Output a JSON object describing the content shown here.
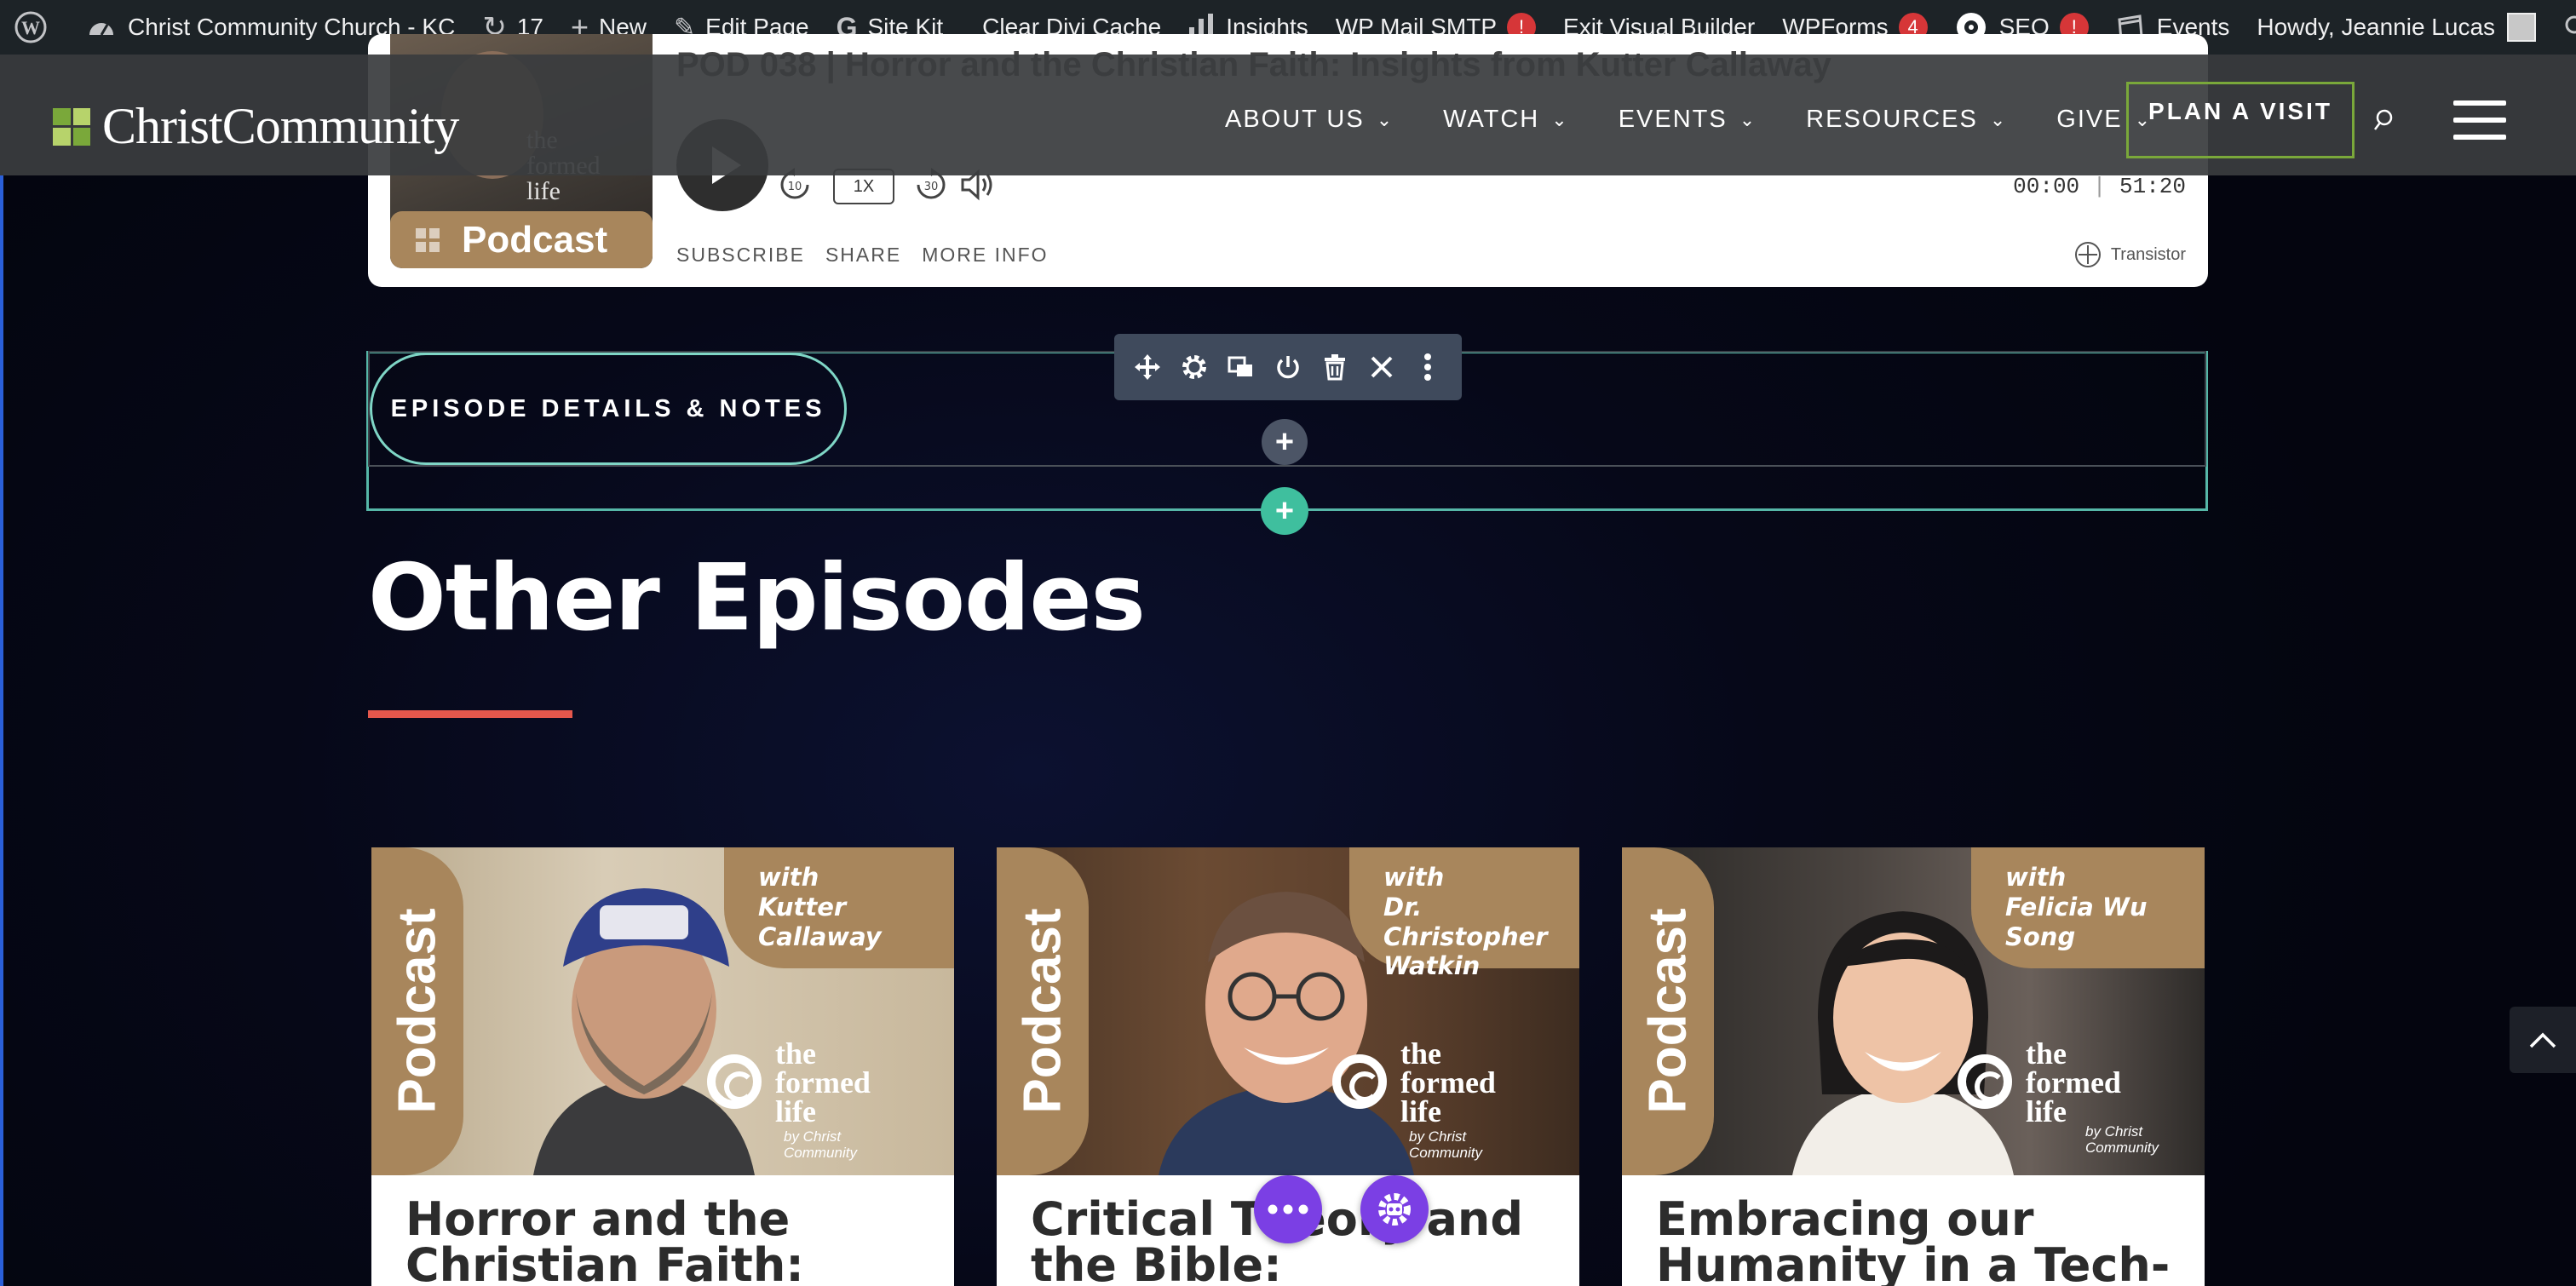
{
  "admin_bar": {
    "site_name": "Christ Community Church - KC",
    "updates_count": "17",
    "new_label": "New",
    "edit_page_label": "Edit Page",
    "site_kit_label": "Site Kit",
    "clear_cache_label": "Clear Divi Cache",
    "insights_label": "Insights",
    "wp_mail_label": "WP Mail SMTP",
    "wp_mail_badge": "!",
    "exit_builder_label": "Exit Visual Builder",
    "wpforms_label": "WPForms",
    "wpforms_badge": "4",
    "seo_label": "SEO",
    "seo_badge": "!",
    "events_label": "Events",
    "howdy_label": "Howdy, Jeannie Lucas"
  },
  "header": {
    "logo_text": "ChristCommunity",
    "nav": [
      {
        "label": "ABOUT US"
      },
      {
        "label": "WATCH"
      },
      {
        "label": "EVENTS"
      },
      {
        "label": "RESOURCES"
      },
      {
        "label": "GIVE"
      }
    ],
    "cta_label": "PLAN A VISIT"
  },
  "player": {
    "title": "POD 038 | Horror and the Christian Faith: Insights from Kutter Callaway",
    "thumb_badge": "Podcast",
    "speed": "1X",
    "skip_back": "10",
    "skip_forward": "30",
    "time_current": "00:00",
    "time_total": "51:20",
    "links": [
      "SUBSCRIBE",
      "SHARE",
      "MORE INFO"
    ],
    "provider": "Transistor"
  },
  "builder": {
    "button_label": "EPISODE DETAILS & NOTES",
    "add_symbol": "+"
  },
  "other_episodes": {
    "heading": "Other Episodes",
    "cards": [
      {
        "strip": "Podcast",
        "with_text": "with\nKutter\nCallaway",
        "brand": "the\nformed\nlife",
        "brand_by": "by Christ\nCommunity",
        "title": "Horror and the Christian Faith:"
      },
      {
        "strip": "Podcast",
        "with_text": "with\nDr. Christopher\nWatkin",
        "brand": "the\nformed\nlife",
        "brand_by": "by Christ\nCommunity",
        "title": "Critical Theory and the Bible: Unpacking"
      },
      {
        "strip": "Podcast",
        "with_text": "with\nFelicia Wu Song",
        "brand": "the\nformed\nlife",
        "brand_by": "by Christ\nCommunity",
        "title": "Embracing our Humanity in a Tech-"
      }
    ]
  },
  "colors": {
    "accent_teal": "#56b7a8",
    "brand_tan": "#a8865c",
    "rule_red": "#e4574c",
    "divi_purple": "#7b3fe4",
    "logo_green": "#7aa83a"
  }
}
